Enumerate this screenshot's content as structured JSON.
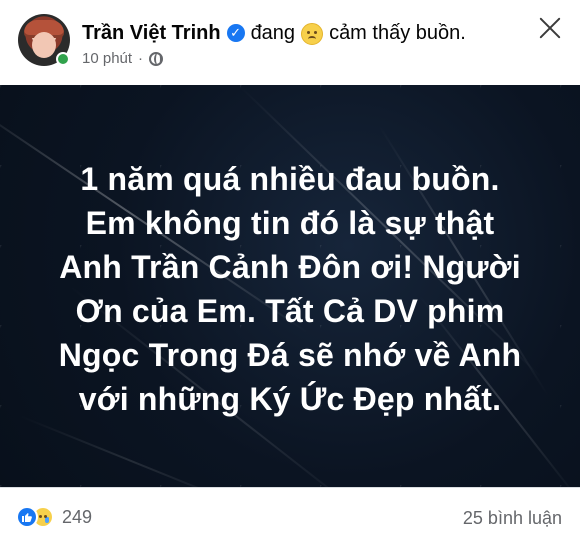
{
  "header": {
    "name": "Trần Việt Trinh",
    "status_prefix": "đang",
    "status_feeling": "cảm thấy buồn.",
    "time": "10 phút",
    "dot": "·",
    "audience_icon": "globe-icon",
    "verified_icon": "verified-check-icon",
    "close_icon": "close-icon"
  },
  "post": {
    "text_lines": [
      "1 năm quá nhiều đau buồn.",
      "Em không tin đó là sự thật",
      "Anh Trần Cảnh Đôn ơi! Người",
      "Ơn của Em. Tất Cả DV phim",
      "Ngọc Trong Đá sẽ nhớ về Anh",
      "với những Ký Ức Đẹp nhất."
    ]
  },
  "footer": {
    "reactions_count": "249",
    "comments_text": "25 bình luận",
    "reaction_icons": [
      "like-icon",
      "sad-icon"
    ]
  }
}
